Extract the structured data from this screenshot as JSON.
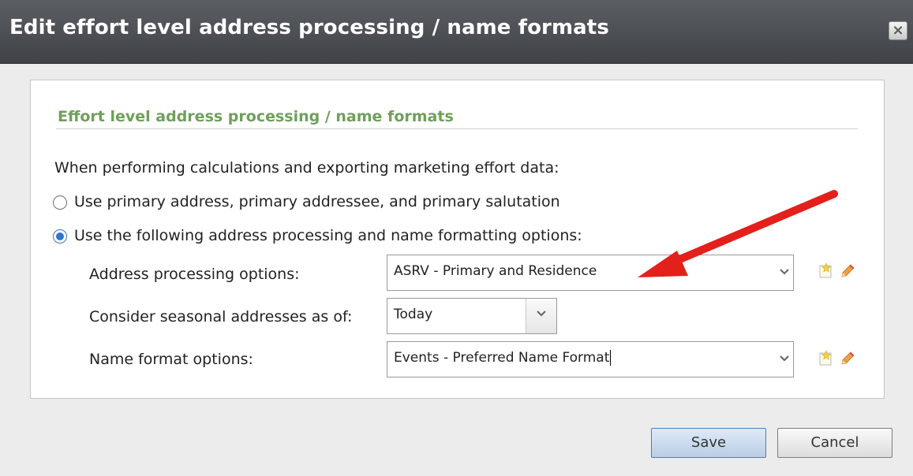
{
  "dialog": {
    "title": "Edit effort level address processing / name formats",
    "close_glyph": "×"
  },
  "section": {
    "title": "Effort level address processing / name formats",
    "intro": "When performing calculations and exporting marketing effort data:"
  },
  "radio_options": [
    {
      "label": "Use primary address, primary addressee, and primary salutation",
      "checked": false
    },
    {
      "label": "Use the following address processing and name formatting options:",
      "checked": true
    }
  ],
  "fields": {
    "address_processing": {
      "label": "Address processing options:",
      "value": "ASRV - Primary and Residence"
    },
    "seasonal": {
      "label": "Consider seasonal addresses as of:",
      "value": "Today"
    },
    "name_format": {
      "label": "Name format options:",
      "value": "Events - Preferred Name Format"
    }
  },
  "buttons": {
    "save": "Save",
    "cancel": "Cancel"
  },
  "icons": {
    "close": "close-icon",
    "dropdown": "chevron-down-icon",
    "new": "new-record-icon",
    "edit": "pencil-icon"
  },
  "colors": {
    "title_bar": "#4a4d52",
    "section_title": "#6ea05a",
    "radio_selected": "#2f74d0",
    "annotation_arrow": "#e3201b",
    "save_button": "#c8d9ee"
  }
}
